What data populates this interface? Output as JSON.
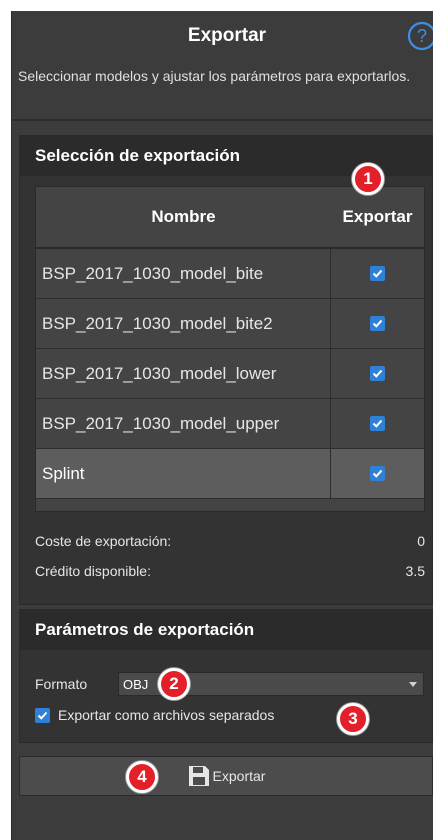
{
  "header": {
    "title": "Exportar",
    "help_icon": "help-icon"
  },
  "description": "Seleccionar modelos y ajustar los parámetros para exportarlos.",
  "selection": {
    "title": "Selección de exportación",
    "columns": {
      "name": "Nombre",
      "export": "Exportar"
    },
    "rows": [
      {
        "name": "BSP_2017_1030_model_bite",
        "checked": true
      },
      {
        "name": "BSP_2017_1030_model_bite2",
        "checked": true
      },
      {
        "name": "BSP_2017_1030_model_lower",
        "checked": true
      },
      {
        "name": "BSP_2017_1030_model_upper",
        "checked": true
      },
      {
        "name": "Splint",
        "checked": true,
        "selected": true
      }
    ],
    "cost_label": "Coste de exportación:",
    "cost_value": "0",
    "credit_label": "Crédito disponible:",
    "credit_value": "3.5"
  },
  "params": {
    "title": "Parámetros de exportación",
    "format_label": "Formato",
    "format_value": "OBJ",
    "separate_label": "Exportar como archivos separados",
    "separate_checked": true
  },
  "export_button": {
    "label": "Exportar",
    "icon": "save-icon"
  },
  "callouts": [
    "1",
    "2",
    "3",
    "4"
  ],
  "colors": {
    "accent": "#2f80d7",
    "callout": "#e3202a",
    "panel": "#3c3c3c"
  }
}
